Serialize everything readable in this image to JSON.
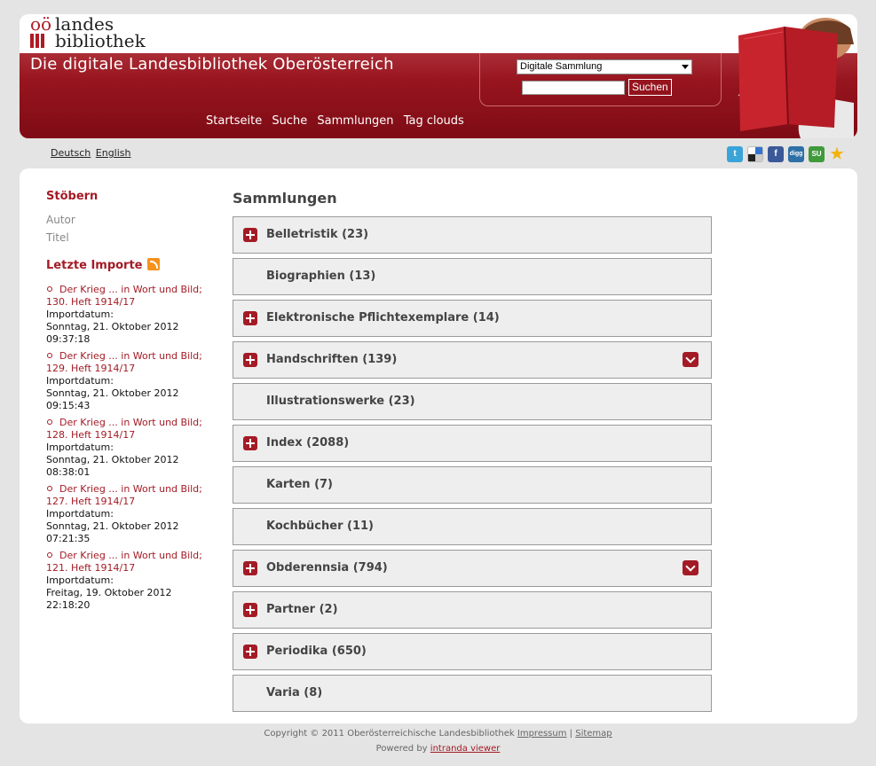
{
  "logo": {
    "line1_prefix": "oö",
    "line1": "landes",
    "line2": "bibliothek"
  },
  "header": {
    "title": "Die digitale Landesbibliothek Oberösterreich"
  },
  "search": {
    "select_value": "Digitale Sammlung",
    "input_value": "",
    "button_label": "Suchen"
  },
  "nav": {
    "items": [
      {
        "label": "Startseite"
      },
      {
        "label": "Suche"
      },
      {
        "label": "Sammlungen"
      },
      {
        "label": "Tag clouds"
      }
    ]
  },
  "languages": [
    {
      "label": "Deutsch"
    },
    {
      "label": "English"
    }
  ],
  "social": [
    {
      "icon": "twitter-icon",
      "glyph": "t",
      "color": "#3aa3d8"
    },
    {
      "icon": "delicious-icon",
      "glyph": "",
      "color": "#222222"
    },
    {
      "icon": "facebook-icon",
      "glyph": "f",
      "color": "#3b5998"
    },
    {
      "icon": "digg-icon",
      "glyph": "digg",
      "color": "#2d6fa6"
    },
    {
      "icon": "stumbleupon-icon",
      "glyph": "SU",
      "color": "#3f9a3b"
    },
    {
      "icon": "favorite-star-icon",
      "glyph": "★",
      "color": "#f2b30a"
    }
  ],
  "sidebar": {
    "browse_heading": "Stöbern",
    "browse_links": [
      {
        "label": "Autor"
      },
      {
        "label": "Titel"
      }
    ],
    "imports_heading": "Letzte Importe",
    "imports": [
      {
        "title": "Der Krieg ... in Wort und Bild; 130. Heft 1914/17",
        "label": "Importdatum:",
        "date": "Sonntag, 21. Oktober 2012 09:37:18"
      },
      {
        "title": "Der Krieg ... in Wort und Bild; 129. Heft 1914/17",
        "label": "Importdatum:",
        "date": "Sonntag, 21. Oktober 2012 09:15:43"
      },
      {
        "title": "Der Krieg ... in Wort und Bild; 128. Heft 1914/17",
        "label": "Importdatum:",
        "date": "Sonntag, 21. Oktober 2012 08:38:01"
      },
      {
        "title": "Der Krieg ... in Wort und Bild; 127. Heft 1914/17",
        "label": "Importdatum:",
        "date": "Sonntag, 21. Oktober 2012 07:21:35"
      },
      {
        "title": "Der Krieg ... in Wort und Bild; 121. Heft 1914/17",
        "label": "Importdatum:",
        "date": "Freitag, 19. Oktober 2012 22:18:20"
      }
    ]
  },
  "content": {
    "title": "Sammlungen",
    "collections": [
      {
        "name": "Belletristik (23)",
        "expandable": true,
        "dropdown": false
      },
      {
        "name": "Biographien (13)",
        "expandable": false,
        "dropdown": false
      },
      {
        "name": "Elektronische Pflichtexemplare (14)",
        "expandable": true,
        "dropdown": false
      },
      {
        "name": "Handschriften (139)",
        "expandable": true,
        "dropdown": true
      },
      {
        "name": "Illustrationswerke (23)",
        "expandable": false,
        "dropdown": false
      },
      {
        "name": "Index (2088)",
        "expandable": true,
        "dropdown": false
      },
      {
        "name": "Karten (7)",
        "expandable": false,
        "dropdown": false
      },
      {
        "name": "Kochbücher (11)",
        "expandable": false,
        "dropdown": false
      },
      {
        "name": "Obderennsia (794)",
        "expandable": true,
        "dropdown": true
      },
      {
        "name": "Partner (2)",
        "expandable": true,
        "dropdown": false
      },
      {
        "name": "Periodika (650)",
        "expandable": true,
        "dropdown": false
      },
      {
        "name": "Varia (8)",
        "expandable": false,
        "dropdown": false
      }
    ]
  },
  "footer": {
    "copyright": "Copyright © 2011 Oberösterreichische Landesbibliothek",
    "impressum": "Impressum",
    "separator": "|",
    "sitemap": "Sitemap",
    "powered_by": "Powered by",
    "powered_link": "intranda viewer"
  },
  "colors": {
    "brand_red": "#a31b25",
    "page_bg": "#e4e4e4"
  }
}
